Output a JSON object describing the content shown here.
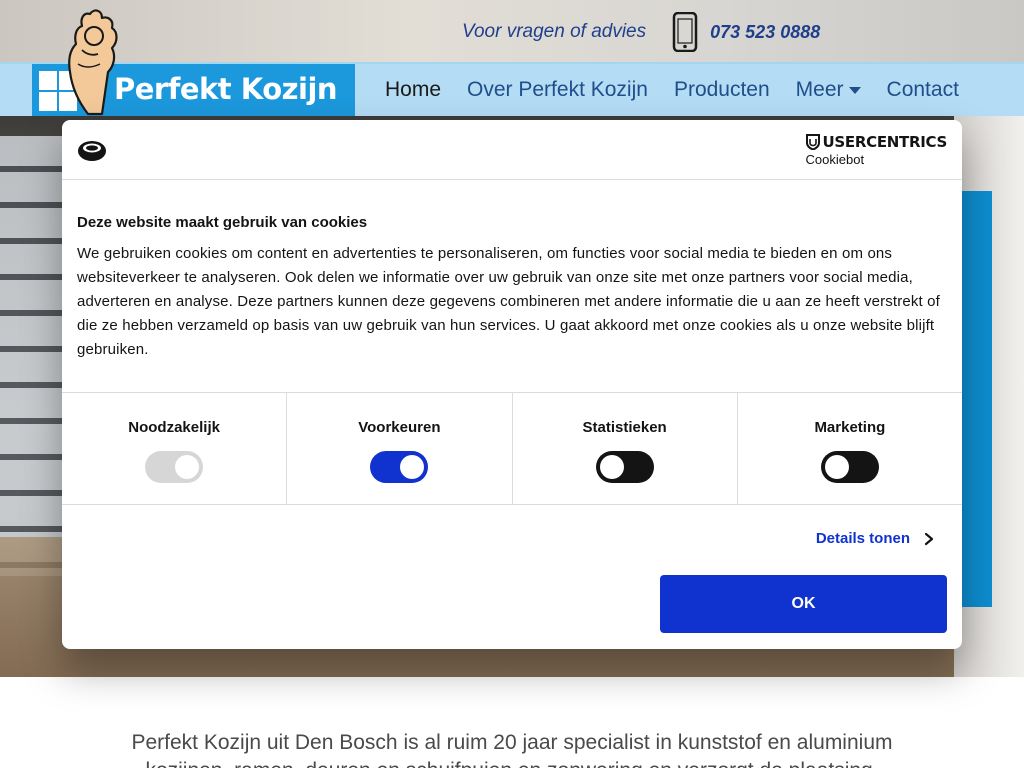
{
  "header": {
    "question": "Voor vragen of advies",
    "phone": "073 523 0888",
    "phone_icon": "mobile-phone-icon"
  },
  "logo": {
    "text": "Perfekt Kozijn",
    "mark_icon": "window-grid-icon",
    "mascot_icon": "ok-hand-icon"
  },
  "nav": {
    "items": [
      {
        "label": "Home",
        "active": true
      },
      {
        "label": "Over Perfekt Kozijn"
      },
      {
        "label": "Producten"
      },
      {
        "label": "Meer",
        "dropdown": true
      },
      {
        "label": "Contact"
      }
    ]
  },
  "cookie": {
    "brand_top": "USERCENTRICS",
    "brand_sub": "Cookiebot",
    "title": "Deze website maakt gebruik van cookies",
    "text": "We gebruiken cookies om content en advertenties te personaliseren, om functies voor social media te bieden en om ons websiteverkeer te analyseren. Ook delen we informatie over uw gebruik van onze site met onze partners voor social media, adverteren en analyse. Deze partners kunnen deze gegevens combineren met andere informatie die u aan ze heeft verstrekt of die ze hebben verzameld op basis van uw gebruik van hun services. U gaat akkoord met onze cookies als u onze website blijft gebruiken.",
    "toggles": [
      {
        "label": "Noodzakelijk",
        "state": "on-disabled"
      },
      {
        "label": "Voorkeuren",
        "state": "on"
      },
      {
        "label": "Statistieken",
        "state": "off"
      },
      {
        "label": "Marketing",
        "state": "off"
      }
    ],
    "details_label": "Details tonen",
    "ok_label": "OK"
  },
  "intro": {
    "line1": "Perfekt Kozijn uit Den Bosch is al ruim 20 jaar specialist in kunststof en aluminium",
    "line2": "kozijnen, ramen, deuren en schuifpuien en zonwering en verzorgt de plaatsing."
  },
  "colors": {
    "brand_blue": "#1c98dc",
    "nav_bg": "#b4dcf4",
    "nav_text": "#1f4e8a",
    "cookie_accent": "#1032cf"
  }
}
